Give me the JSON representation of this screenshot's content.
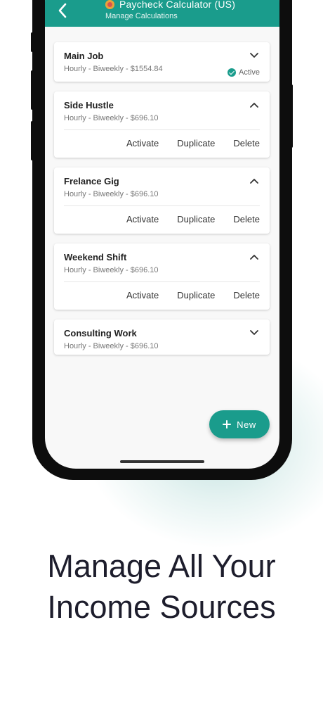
{
  "app": {
    "title": "Paycheck Calculator (US)",
    "subtitle": "Manage Calculations",
    "icons": {
      "back": "chevron-left-icon",
      "logo": "app-logo-icon"
    }
  },
  "cards": [
    {
      "title": "Main Job",
      "subtitle": "Hourly - Biweekly - $1554.84",
      "expanded": false,
      "status": "Active"
    },
    {
      "title": "Side Hustle",
      "subtitle": "Hourly - Biweekly - $696.10",
      "expanded": true
    },
    {
      "title": "Frelance Gig",
      "subtitle": "Hourly - Biweekly - $696.10",
      "expanded": true
    },
    {
      "title": "Weekend Shift",
      "subtitle": "Hourly - Biweekly - $696.10",
      "expanded": true
    },
    {
      "title": "Consulting Work",
      "subtitle": "Hourly - Biweekly - $696.10",
      "expanded": false
    }
  ],
  "actions": {
    "activate": "Activate",
    "duplicate": "Duplicate",
    "delete": "Delete"
  },
  "fab": {
    "label": "New",
    "icon": "plus-icon"
  },
  "headline": {
    "line1": "Manage All Your",
    "line2": "Income Sources"
  },
  "colors": {
    "primary": "#1a9c8c",
    "headline": "#1d1d2c",
    "background": "#ffffff"
  }
}
